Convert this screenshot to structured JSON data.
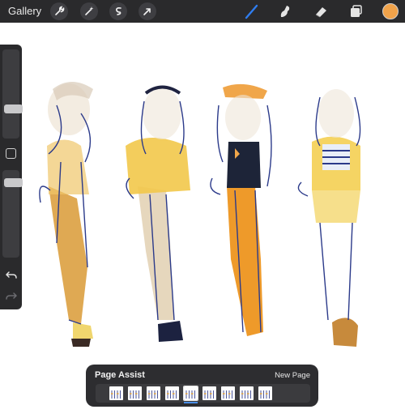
{
  "toolbar": {
    "gallery_label": "Gallery",
    "left_tools": [
      "wrench-icon",
      "magic-wand-icon",
      "selection-icon",
      "transform-arrow-icon"
    ],
    "right_tools": [
      "brush-icon",
      "smudge-icon",
      "eraser-icon",
      "layers-icon"
    ],
    "active_tool": "brush-icon",
    "current_color": "#f0a24a",
    "accent": "#2f7df0"
  },
  "sidebar": {
    "brush_size_level": 0.27,
    "opacity_level": 0.1
  },
  "page_assist": {
    "title": "Page Assist",
    "new_page_label": "New Page",
    "page_count": 9,
    "selected_page": 5
  }
}
